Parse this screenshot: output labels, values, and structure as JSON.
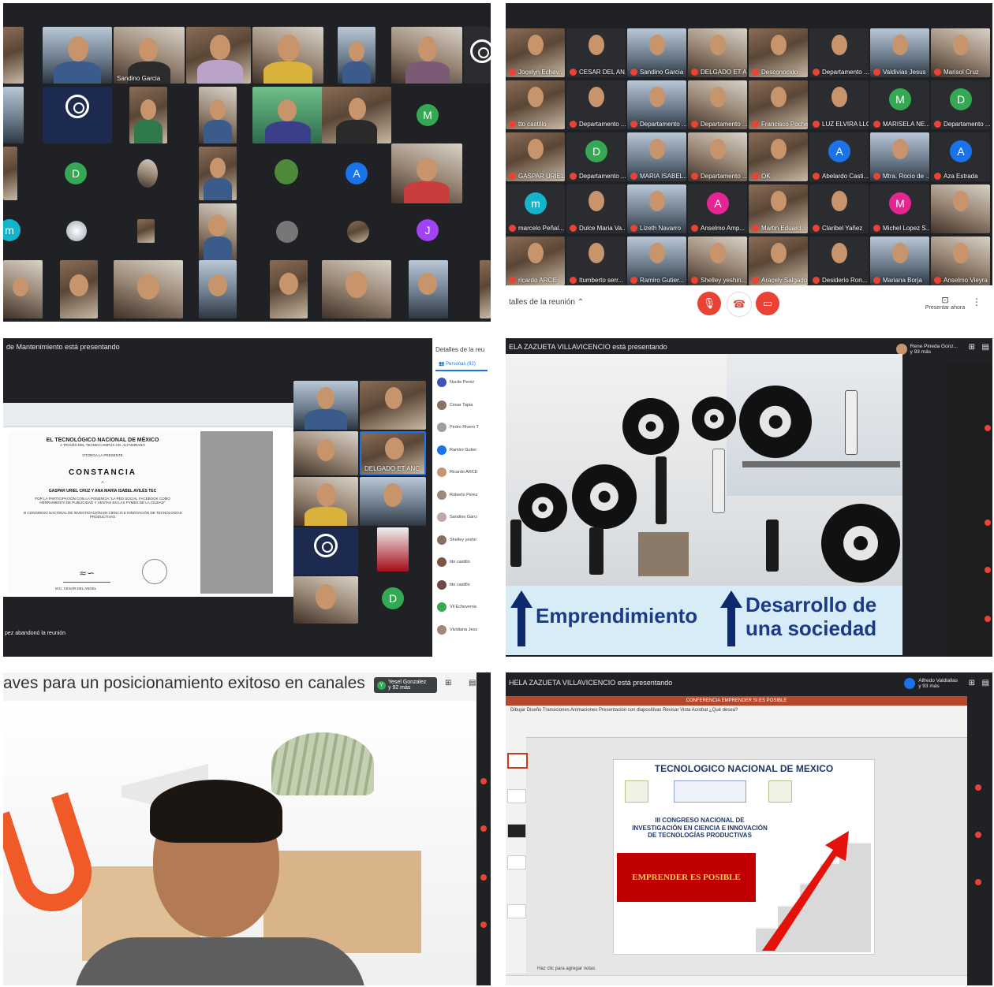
{
  "colors": {
    "meet_dark": "#202124",
    "meet_red": "#ea4335",
    "avatar_green": "#34a853",
    "avatar_teal": "#12b5cb",
    "avatar_purple": "#a142f4",
    "avatar_blue": "#1a73e8",
    "avatar_pink": "#e52592",
    "slide_navy": "#1a3a8a",
    "ppt_red": "#c00000"
  },
  "panel1": {
    "tile_names": [
      "Sandino Garcia"
    ],
    "avatars": [
      "M",
      "D",
      "A",
      "m",
      "J"
    ]
  },
  "panel2": {
    "tile_names": [
      "Jocelyn Echev...",
      "CESAR DEL AN...",
      "Sandino Garcia",
      "DELGADO ET AR...",
      "Desconocido",
      "Departamento ...",
      "Valdivias Jesus",
      "Marisol Cruz",
      "tto castillo",
      "Departamento ...",
      "Departamento ...",
      "Departamento ...",
      "Francisco Poche",
      "LUZ ELVIRA LLC",
      "MARISELA NE...",
      "Departamento ...",
      "GASPAR URIEL",
      "Departamento ...",
      "MARIA ISABEL...",
      "Departamento ...",
      "OK",
      "Abelardo Casti...",
      "Mtra. Rocio de ...",
      "Aza Estrada",
      "marcelo Peñal...",
      "Dulce Maria Va...",
      "Lizeth Navarro",
      "Anselmo Amp...",
      "Martin Eduard...",
      "Claribel Yañez",
      "Michel Lopez S...",
      "",
      "ricardo ARCE",
      "Itumberto serr...",
      "Ramiro Gutier...",
      "Shelley yeshin...",
      "Aracely Salgado",
      "Desiderio Ron...",
      "Mariana Borja",
      "Anselmo Vieyra"
    ],
    "avatars": [
      "M",
      "D",
      "D",
      "A",
      "A",
      "m",
      "A",
      "M"
    ],
    "details_label": "talles de la reunión",
    "present_label": "Presentar ahora"
  },
  "panel3": {
    "presenting": "de Mantenimiento está presentando",
    "details_header": "Detalles de la reu",
    "people_tab": "Personas (92)",
    "people": [
      "Nucile Perez",
      "Cesar Tapia",
      "Pedro Rivero T",
      "Ramiro Gutier",
      "Ricardo ARCE",
      "Roberto Perez",
      "Sandino Garci",
      "Shelley yeshir",
      "tito castillo",
      "tito castillo",
      "Vil Echeverria",
      "Vividiana Jess"
    ],
    "tile_label": "DELGADO ET ANC",
    "left_note": "pez abandonó la reunión",
    "avatar": "D",
    "doc": {
      "heading": "EL TECNOLÓGICO NACIONAL DE MÉXICO",
      "subheading": "A TRAVÉS DEL TECNM CAMPUS CD. ALTAMIRANO",
      "grants": "OTORGA LA PRESENTE",
      "title": "CONSTANCIA",
      "to": "A",
      "names": "GASPAR URIEL CRUZ Y ANA MARÍA ISABEL AVILÉS TEC",
      "body": "POR LA PARTICIPACIÓN CON LA PONENCIA \"LA RED SOCIAL FACEBOOK COMO HERRAMIENTA DE PUBLICIDAD Y VENTAS EN LAS PYMES DE LA CIUDAD\"",
      "congress": "III CONGRESO NACIONAL DE INVESTIGACIÓN EN CIENCIA E INNOVACIÓN DE TECNOLOGÍAS PRODUCTIVAS",
      "signer": "M.C. CESAR DEL ANGEL"
    }
  },
  "panel4": {
    "presenting": "ELA ZAZUETA VILLAVICENCIO está presentando",
    "tag_name": "Rene Pineda Gonz...",
    "tag_count": "y 93 más",
    "word_left": "Emprendimiento",
    "word_right_line1": "Desarrollo de",
    "word_right_line2": "una sociedad"
  },
  "panel5": {
    "title": "aves para un posicionamiento exitoso en canales",
    "tag_letter": "Y",
    "tag_name": "Yesel Gonzalez",
    "tag_count": "y 92 más"
  },
  "panel6": {
    "presenting": "HELA ZAZUETA VILLAVICENCIO está presentando",
    "tag_name": "Alfredo Valdiallas",
    "tag_count": "y 93 más",
    "window_title": "CONFERENCIA EMPRENDER SI ES POSIBLE",
    "ribbon_tabs": "Dibujar   Diseño   Transiciones   Animaciones   Presentación con diapositivas   Revisar   Vista   Acrobat   ¿Qué desea?",
    "slide_title": "TECNOLOGICO NACIONAL DE MEXICO",
    "slide_text_1": "III CONGRESO NACIONAL DE",
    "slide_text_2": "INVESTIGACIÓN EN CIENCIA E INNOVACIÓN",
    "slide_text_3": "DE TECNOLOGÍAS PRODUCTIVAS",
    "slide_banner": "EMPRENDER ES POSIBLE",
    "notes": "Haz clic para agregar notas"
  }
}
